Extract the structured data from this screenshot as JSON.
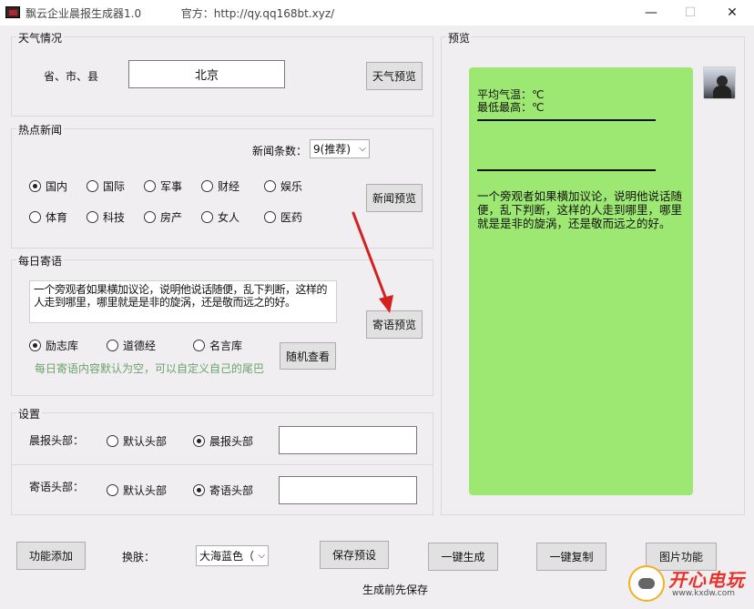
{
  "window": {
    "title": "飘云企业晨报生成器1.0",
    "official": "官方：http://qy.qq168bt.xyz/",
    "minimize": "—",
    "maximize": "☐",
    "close": "✕"
  },
  "weather": {
    "legend": "天气情况",
    "region_label": "省、市、县",
    "region_value": "北京",
    "preview_button": "天气预览"
  },
  "news": {
    "legend": "热点新闻",
    "count_label": "新闻条数：",
    "count_value": "9(推荐)",
    "categories": [
      "国内",
      "国际",
      "军事",
      "财经",
      "娱乐",
      "体育",
      "科技",
      "房产",
      "女人",
      "医药"
    ],
    "selected": "国内",
    "preview_button": "新闻预览"
  },
  "quote": {
    "legend": "每日寄语",
    "text": "一个旁观者如果横加议论，说明他说话随便，乱下判断，这样的人走到哪里，哪里就是是非的旋涡，还是敬而远之的好。",
    "sources": [
      "励志库",
      "道德经",
      "名言库"
    ],
    "selected": "励志库",
    "preview_button": "寄语预览",
    "random_button": "随机查看",
    "hint": "每日寄语内容默认为空，可以自定义自己的尾巴"
  },
  "settings": {
    "legend": "设置",
    "morning_label": "晨报头部：",
    "morning_options": [
      "默认头部",
      "晨报头部"
    ],
    "morning_selected": "晨报头部",
    "quote_label": "寄语头部：",
    "quote_options": [
      "默认头部",
      "寄语头部"
    ],
    "quote_selected": "寄语头部"
  },
  "preview": {
    "legend": "预览",
    "line1": "平均气温：℃",
    "line2": "最低最高：℃",
    "body": "一个旁观者如果横加议论，说明他说话随便，乱下判断，这样的人走到哪里，哪里就是是非的旋涡，还是敬而远之的好。",
    "bubble_color": "#9de872"
  },
  "footer": {
    "add_feature": "功能添加",
    "skin_label": "换肤：",
    "skin_value": "大海蓝色（",
    "save_preset": "保存预设",
    "generate": "一键生成",
    "copy": "一键复制",
    "image_func": "图片功能",
    "save_hint": "生成前先保存"
  },
  "watermark": {
    "text": "开心电玩",
    "url": "www.kxdw.com"
  }
}
